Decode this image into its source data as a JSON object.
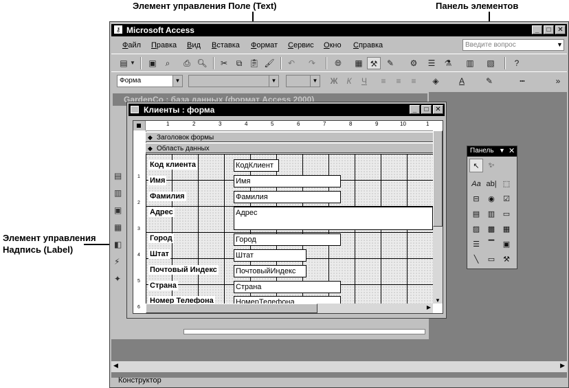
{
  "callouts": {
    "text_control": "Элемент управления Поле (Text)",
    "toolbox": "Панель элементов",
    "label_control_line1": "Элемент управления",
    "label_control_line2": "Надпись (Label)"
  },
  "app": {
    "title": "Microsoft Access",
    "menu": [
      "Файл",
      "Правка",
      "Вид",
      "Вставка",
      "Формат",
      "Сервис",
      "Окно",
      "Справка"
    ],
    "ask_placeholder": "Введите вопрос",
    "object_combo": "Форма",
    "status": "Конструктор"
  },
  "db_window": {
    "title": "GardenCo : база данных (формат Access 2000)"
  },
  "form_window": {
    "title": "Клиенты : форма",
    "sections": {
      "header": "Заголовок формы",
      "detail": "Область данных"
    },
    "ruler_top": [
      "1",
      "2",
      "3",
      "4",
      "5",
      "6",
      "7",
      "8",
      "9",
      "10",
      "1"
    ],
    "ruler_left": [
      "1",
      "2",
      "3",
      "4",
      "5",
      "6"
    ],
    "fields": [
      {
        "label": "Код клиента",
        "control": "КодКлиент"
      },
      {
        "label": "Имя",
        "control": "Имя"
      },
      {
        "label": "Фамилия",
        "control": "Фамилия"
      },
      {
        "label": "Адрес",
        "control": "Адрес"
      },
      {
        "label": "Город",
        "control": "Город"
      },
      {
        "label": "Штат",
        "control": "Штат"
      },
      {
        "label": "Почтовый Индекс",
        "control": "ПочтовыйИндекс"
      },
      {
        "label": "Страна",
        "control": "Страна"
      },
      {
        "label": "Номер Телефона",
        "control": "НомерТелефона"
      }
    ]
  },
  "toolbox": {
    "title": "Панель"
  }
}
